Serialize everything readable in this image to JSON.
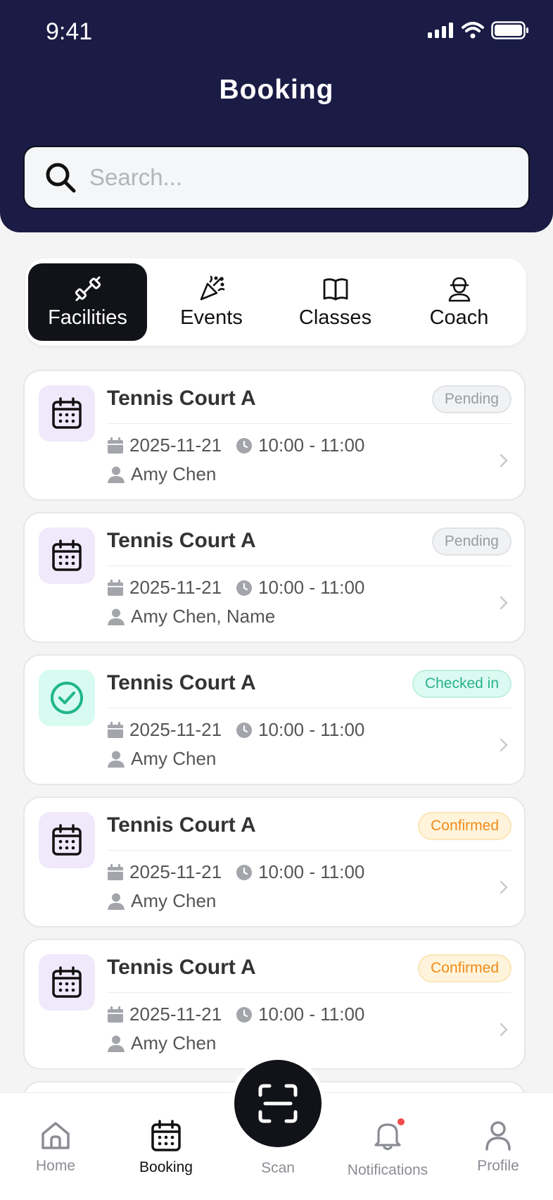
{
  "status": {
    "time": "9:41"
  },
  "header": {
    "title": "Booking"
  },
  "search": {
    "placeholder": "Search..."
  },
  "tabs": [
    {
      "label": "Facilities",
      "icon": "dumbbell-icon",
      "active": true
    },
    {
      "label": "Events",
      "icon": "party-popper-icon",
      "active": false
    },
    {
      "label": "Classes",
      "icon": "book-icon",
      "active": false
    },
    {
      "label": "Coach",
      "icon": "coach-icon",
      "active": false
    }
  ],
  "bookings": [
    {
      "name": "Tennis Court A",
      "status": "Pending",
      "status_type": "pending",
      "date": "2025-11-21",
      "time": "10:00 - 11:00",
      "people": "Amy Chen",
      "icon": "calendar-icon"
    },
    {
      "name": "Tennis Court A",
      "status": "Pending",
      "status_type": "pending",
      "date": "2025-11-21",
      "time": "10:00 - 11:00",
      "people": "Amy Chen, Name",
      "icon": "calendar-icon"
    },
    {
      "name": "Tennis Court A",
      "status": "Checked in",
      "status_type": "checked",
      "date": "2025-11-21",
      "time": "10:00 - 11:00",
      "people": "Amy Chen",
      "icon": "check-circle-icon"
    },
    {
      "name": "Tennis Court A",
      "status": "Confirmed",
      "status_type": "confirmed",
      "date": "2025-11-21",
      "time": "10:00 - 11:00",
      "people": "Amy Chen",
      "icon": "calendar-icon"
    },
    {
      "name": "Tennis Court A",
      "status": "Confirmed",
      "status_type": "confirmed",
      "date": "2025-11-21",
      "time": "10:00 - 11:00",
      "people": "Amy Chen",
      "icon": "calendar-icon"
    }
  ],
  "nav": {
    "home": "Home",
    "booking": "Booking",
    "scan": "Scan",
    "notifications": "Notifications",
    "profile": "Profile"
  },
  "colors": {
    "header_bg": "#1a1c45",
    "active_tab": "#111318",
    "pending": "#9a9ca3",
    "checked_in": "#28b28a",
    "confirmed": "#ef8a19",
    "notification_dot": "#f24a4a"
  }
}
